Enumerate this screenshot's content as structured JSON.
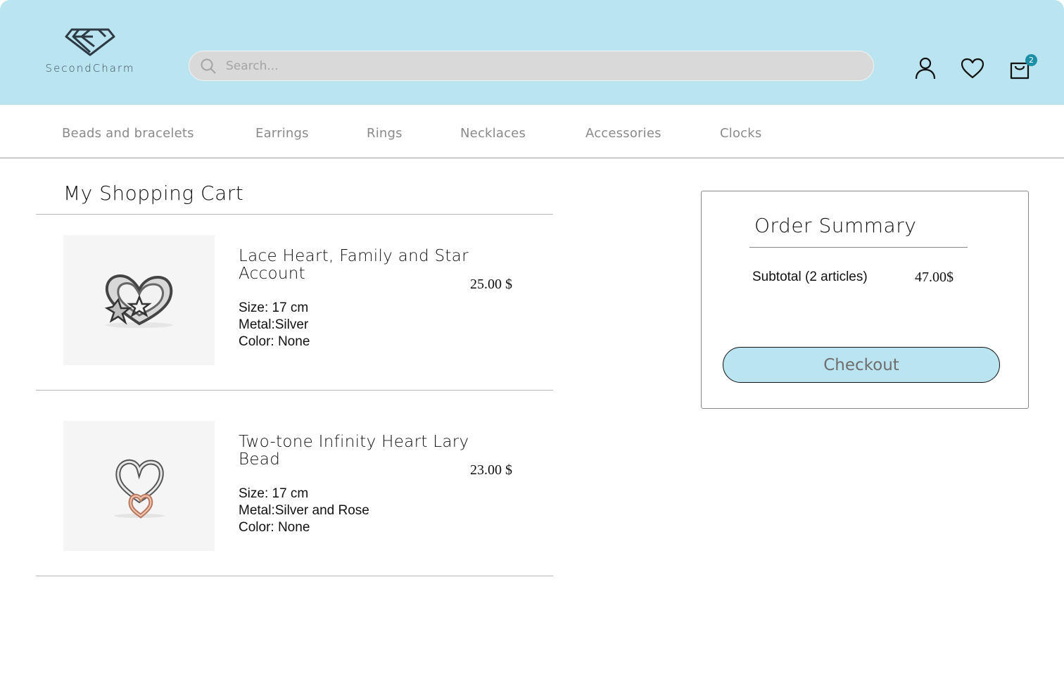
{
  "header": {
    "brand": "SecondCharm",
    "search_placeholder": "Search...",
    "cart_count": "2",
    "icons": [
      "user-icon",
      "heart-icon",
      "shopping-bag-icon",
      "search-icon",
      "diamond-logo-icon"
    ]
  },
  "nav": {
    "items": [
      {
        "label": "Beads and bracelets"
      },
      {
        "label": "Earrings"
      },
      {
        "label": "Rings"
      },
      {
        "label": "Necklaces"
      },
      {
        "label": "Accessories"
      },
      {
        "label": "Clocks"
      }
    ]
  },
  "cart": {
    "title": "My Shopping Cart",
    "items": [
      {
        "name": "Lace Heart, Family and Star Account",
        "price": "25.00 $",
        "size": "Size: 17 cm",
        "metal": "Metal:Silver",
        "color": "Color: None"
      },
      {
        "name": "Two-tone Infinity Heart Lary Bead",
        "price": "23.00 $",
        "size": "Size: 17 cm",
        "metal": "Metal:Silver and Rose",
        "color": "Color: None"
      }
    ]
  },
  "summary": {
    "title": "Order Summary",
    "subtotal_label": "Subtotal (2 articles)",
    "subtotal_value": "47.00$",
    "checkout_label": "Checkout"
  },
  "colors": {
    "header_bg": "#bae4ef",
    "badge": "#1a8fa6",
    "search_bg": "#d9d9d9",
    "nav_text": "#8a8a8a"
  }
}
